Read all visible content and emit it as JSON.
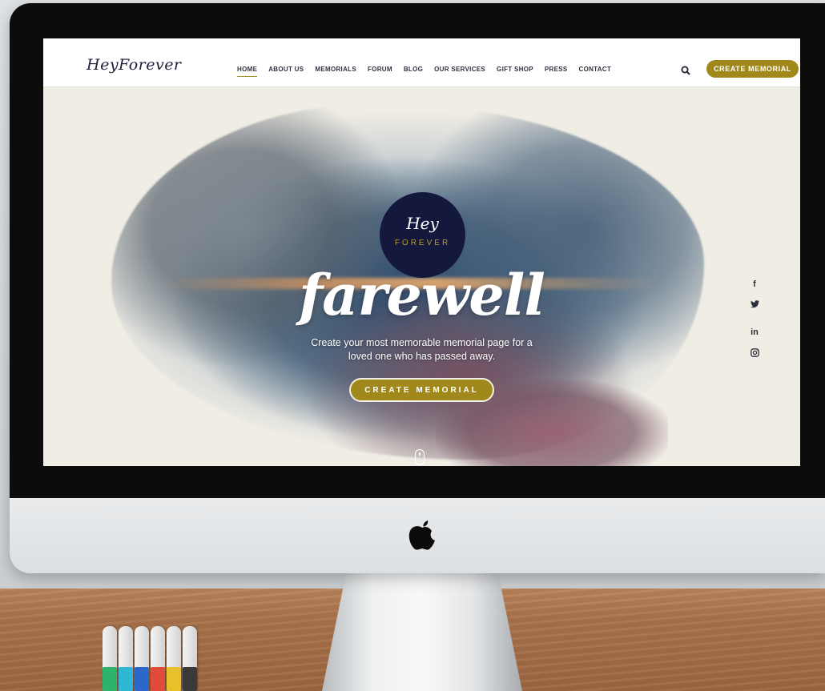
{
  "site": {
    "logo_text": "HeyForever"
  },
  "nav": {
    "items": [
      {
        "label": "HOME",
        "active": true
      },
      {
        "label": "ABOUT US",
        "active": false
      },
      {
        "label": "MEMORIALS",
        "active": false
      },
      {
        "label": "FORUM",
        "active": false
      },
      {
        "label": "BLOG",
        "active": false
      },
      {
        "label": "OUR SERVICES",
        "active": false
      },
      {
        "label": "GIFT SHOP",
        "active": false
      },
      {
        "label": "PRESS",
        "active": false
      },
      {
        "label": "CONTACT",
        "active": false
      }
    ],
    "cta_label": "CREATE MEMORIAL"
  },
  "hero": {
    "badge_script": "Hey",
    "badge_word": "FOREVER",
    "headline": "farewell",
    "subline_1": "Create your most memorable memorial page for a",
    "subline_2": "loved one who has passed away.",
    "cta_label": "CREATE MEMORIAL"
  },
  "social": {
    "facebook": "f",
    "twitter": "twitter-icon",
    "linkedin": "in",
    "instagram": "instagram-icon"
  },
  "colors": {
    "accent_gold": "#a0891a",
    "badge_navy": "#14183d",
    "screen_bg": "#f0ede5"
  },
  "icons": [
    "search-icon",
    "apple-logo-icon",
    "scroll-mouse-icon",
    "facebook-icon",
    "twitter-icon",
    "linkedin-icon",
    "instagram-icon"
  ]
}
